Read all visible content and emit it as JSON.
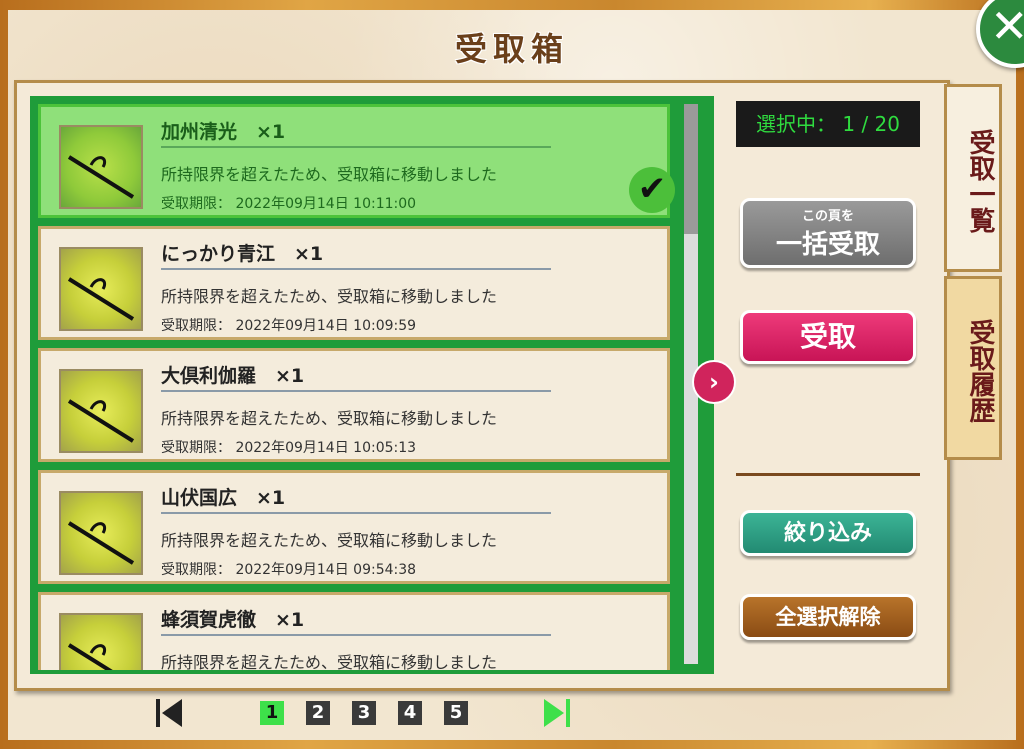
{
  "title": "受取箱",
  "counter": "選択中： 1 / 20",
  "items": [
    {
      "name": "加州清光　×1",
      "message": "所持限界を超えたため、受取箱に移動しました",
      "deadline": "受取期限： 2022年09月14日 10:11:00",
      "selected": true
    },
    {
      "name": "にっかり青江　×1",
      "message": "所持限界を超えたため、受取箱に移動しました",
      "deadline": "受取期限： 2022年09月14日 10:09:59",
      "selected": false
    },
    {
      "name": "大倶利伽羅　×1",
      "message": "所持限界を超えたため、受取箱に移動しました",
      "deadline": "受取期限： 2022年09月14日 10:05:13",
      "selected": false
    },
    {
      "name": "山伏国広　×1",
      "message": "所持限界を超えたため、受取箱に移動しました",
      "deadline": "受取期限： 2022年09月14日 09:54:38",
      "selected": false
    },
    {
      "name": "蜂須賀虎徹　×1",
      "message": "所持限界を超えたため、受取箱に移動しました",
      "deadline": "",
      "selected": false
    }
  ],
  "buttons": {
    "bulk_small": "この頁を",
    "bulk_big": "一括受取",
    "receive": "受取",
    "filter": "絞り込み",
    "deselect_all": "全選択解除"
  },
  "tabs": {
    "list": "受取一覧",
    "history": "受取履歴"
  },
  "pagination": {
    "pages": [
      "1",
      "2",
      "3",
      "4",
      "5"
    ],
    "current": "1"
  },
  "icons": {
    "close": "close-icon",
    "next": "chevron-right-icon",
    "check": "checkmark-icon",
    "first": "first-page-icon",
    "last": "last-page-icon"
  },
  "colors": {
    "selected_item": "#8fe07a",
    "list_border": "#1f9c3a",
    "receive_button": "#d81b5e",
    "filter_button": "#2a9e82",
    "deselect_button": "#a05e1c",
    "bulk_button": "#8a8a8a",
    "counter_text": "#2fdc3f"
  }
}
